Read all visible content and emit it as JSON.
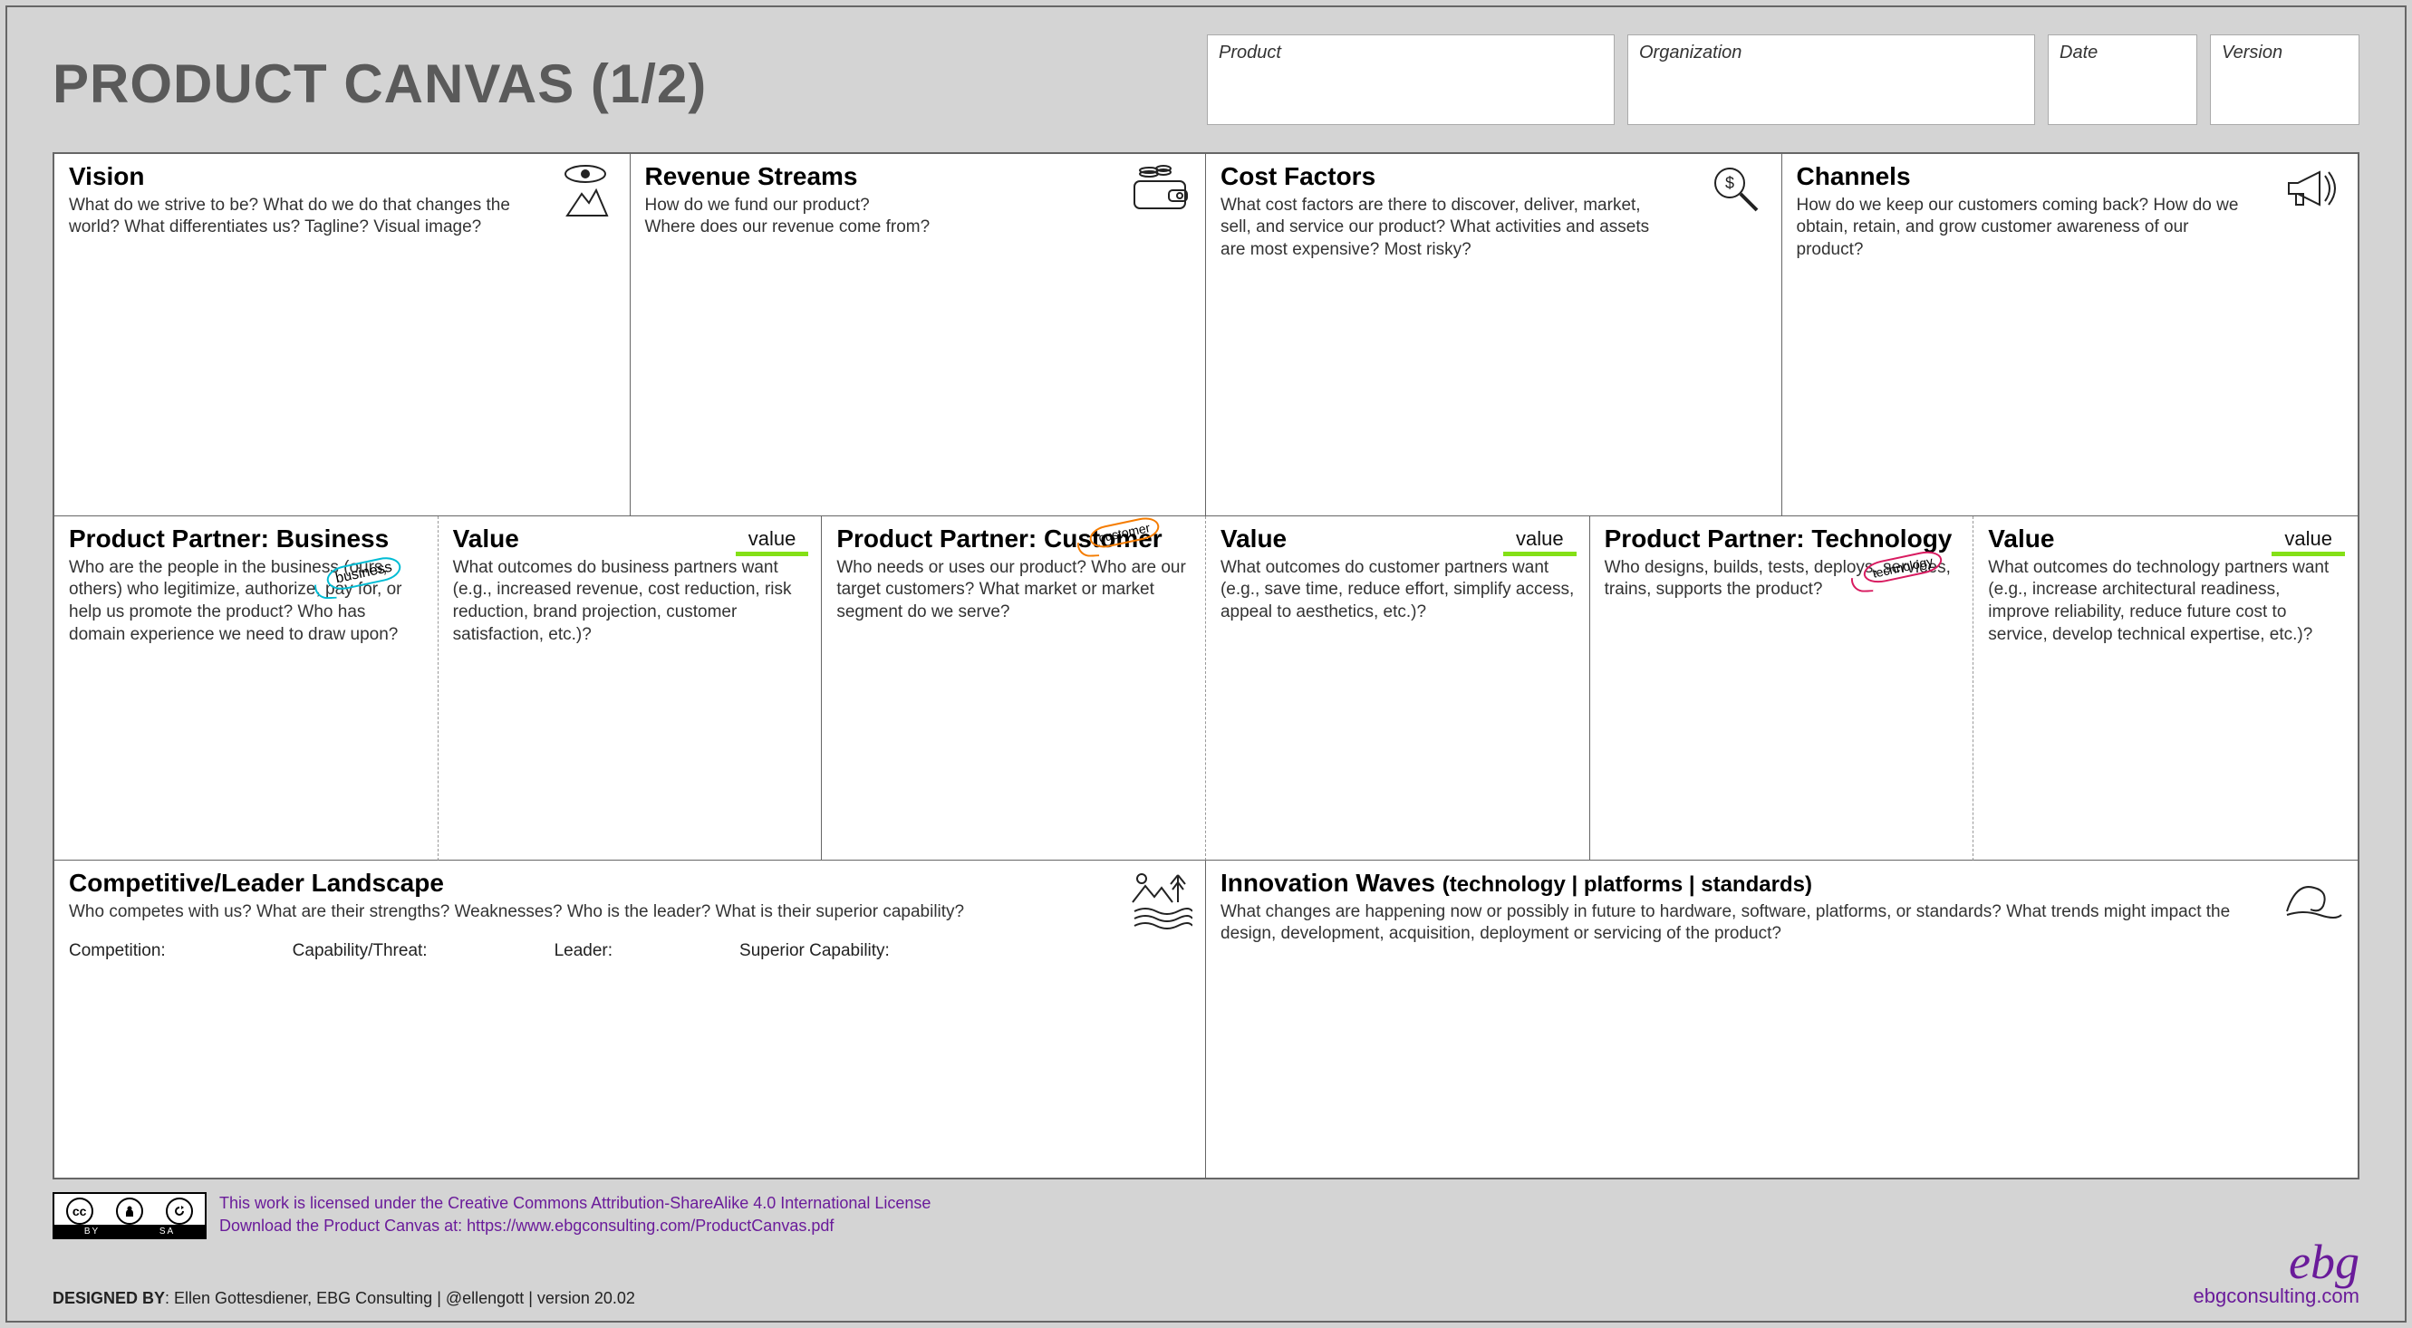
{
  "title": "PRODUCT CANVAS (1/2)",
  "meta": {
    "product_label": "Product",
    "organization_label": "Organization",
    "date_label": "Date",
    "version_label": "Version"
  },
  "cells": {
    "vision": {
      "title": "Vision",
      "desc": "What do we strive to be? What do we do that changes the world? What differentiates us? Tagline? Visual image?"
    },
    "revenue": {
      "title": "Revenue Streams",
      "desc": "How do we fund our product?\nWhere does our revenue come from?"
    },
    "cost": {
      "title": "Cost Factors",
      "desc": "What cost factors are there to discover, deliver, market, sell, and service our product? What activities and assets are most expensive? Most risky?"
    },
    "channels": {
      "title": "Channels",
      "desc": "How do we keep our customers coming back? How do we obtain, retain, and grow customer awareness of our product?"
    },
    "partner_business": {
      "title": "Product Partner: Business",
      "desc": "Who are the people in the business (ours, others) who legitimize, authorize, pay for, or help us promote the product? Who has domain experience we need to draw upon?",
      "bubble": "business"
    },
    "value_business": {
      "title": "Value",
      "desc": "What outcomes do business partners want (e.g., increased revenue, cost reduction, risk reduction, brand projection, customer satisfaction, etc.)?",
      "tag": "value"
    },
    "partner_customer": {
      "title": "Product Partner: Customer",
      "desc": "Who needs or uses our product? Who are our target customers? What market or market segment do we serve?",
      "bubble": "customer"
    },
    "value_customer": {
      "title": "Value",
      "desc": "What outcomes do customer partners want (e.g., save time, reduce effort, simplify access, appeal to aesthetics, etc.)?",
      "tag": "value"
    },
    "partner_technology": {
      "title": "Product Partner: Technology",
      "desc": "Who designs, builds, tests, deploys, services, trains, supports the product?",
      "bubble": "technology"
    },
    "value_technology": {
      "title": "Value",
      "desc": "What outcomes do technology partners want (e.g., increase architectural readiness, improve reliability, reduce future cost to service, develop technical expertise, etc.)?",
      "tag": "value"
    },
    "competitive": {
      "title": "Competitive/Leader Landscape",
      "desc": "Who competes with us? What are their strengths? Weaknesses? Who is the leader? What is their superior capability?",
      "labels": {
        "competition": "Competition:",
        "capability_threat": "Capability/Threat:",
        "leader": "Leader:",
        "superior_capability": "Superior Capability:"
      }
    },
    "innovation": {
      "title": "Innovation Waves",
      "subtitle": "(technology  |  platforms |  standards)",
      "desc": "What changes are happening now or possibly in future to hardware, software, platforms, or standards? What trends might impact the design, development, acquisition, deployment or servicing of the product?"
    }
  },
  "footer": {
    "license_line": "This work is licensed under the Creative Commons Attribution-ShareAlike 4.0 International License",
    "download_line": "Download the Product Canvas at: https://www.ebgconsulting.com/ProductCanvas.pdf",
    "designed_by_label": "DESIGNED BY",
    "designed_by_value": ": Ellen Gottesdiener, EBG Consulting | @ellengott | version 20.02",
    "cc_segments": {
      "by": "BY",
      "sa": "SA"
    },
    "logo_script": "ebg",
    "logo_url": "ebgconsulting.com"
  }
}
